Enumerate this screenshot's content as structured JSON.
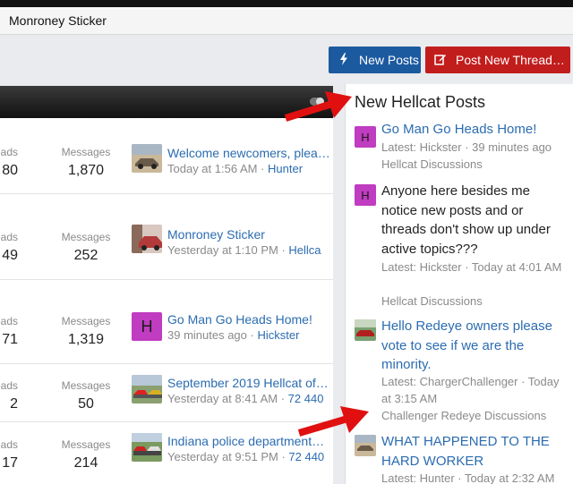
{
  "window": {
    "title": "Monroney Sticker"
  },
  "toolbar": {
    "new_posts_label": "New Posts",
    "post_thread_label": "Post New Thread…"
  },
  "forums": {
    "threads_label": "reads",
    "messages_label": "Messages",
    "rows": [
      {
        "threads": "80",
        "messages": "1,870",
        "latest_title": "Welcome newcomers, plea…",
        "latest_time": "Today at 1:56 AM",
        "latest_user": "Hunter"
      },
      {
        "threads": "49",
        "messages": "252",
        "latest_title": "Monroney Sticker",
        "latest_time": "Yesterday at 1:10 PM",
        "latest_user": "Hellca"
      },
      {
        "threads": "71",
        "messages": "1,319",
        "latest_title": "Go Man Go Heads Home!",
        "latest_time": "39 minutes ago",
        "latest_user": "Hickster",
        "avatar_letter": "H"
      },
      {
        "threads": "2",
        "messages": "50",
        "latest_title": "September 2019 Hellcat of…",
        "latest_time": "Yesterday at 8:41 AM",
        "latest_user": "72 440"
      },
      {
        "threads": "17",
        "messages": "214",
        "latest_title": "Indiana police department…",
        "latest_time": "Yesterday at 9:51 PM",
        "latest_user": "72 440"
      }
    ]
  },
  "sidebar": {
    "title": "New Hellcat Posts",
    "posts": [
      {
        "avatar_letter": "H",
        "title": "Go Man Go Heads Home!",
        "meta1": "Latest: Hickster · 39 minutes ago",
        "meta2": "Hellcat Discussions"
      },
      {
        "avatar_letter": "H",
        "title": "Anyone here besides me notice new posts and or threads don't show up under active topics???",
        "meta1": "Latest: Hickster · Today at 4:01 AM",
        "meta2": "Hellcat Discussions"
      },
      {
        "title": "Hello Redeye owners please vote to see if we are the minority.",
        "meta1": "Latest: ChargerChallenger · Today at 3:15 AM",
        "meta2": "Challenger Redeye Discussions"
      },
      {
        "title": "WHAT HAPPENED TO THE HARD WORKER",
        "meta1": "Latest: Hunter · Today at 2:32 AM",
        "meta2": ""
      }
    ]
  },
  "colors": {
    "accent_blue": "#1c5aa0",
    "accent_red": "#c21d1d",
    "link": "#2b6cb0",
    "arrow": "#e01010",
    "avatar": "#c03cc0"
  }
}
